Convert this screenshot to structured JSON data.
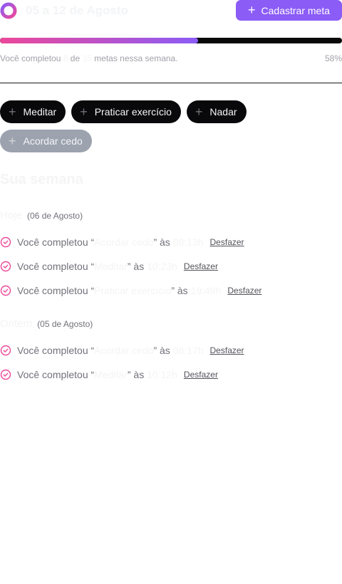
{
  "header": {
    "week_range": "05 a 12 de Agosto",
    "add_goal_label": "Cadastrar meta",
    "logo_icon": "in-orbit-logo-icon",
    "plus_icon": "plus-icon"
  },
  "progress": {
    "fraction": 0.58,
    "text_prefix": "Você completou",
    "completed": "8",
    "text_of": "de",
    "total": "15",
    "text_suffix": "metas nessa semana.",
    "percent_label": "58%",
    "gradient_start": "#ec4899",
    "gradient_end": "#8b5cf6"
  },
  "pending_goals": [
    {
      "label": "Meditar",
      "disabled": false
    },
    {
      "label": "Praticar exercício",
      "disabled": false
    },
    {
      "label": "Nadar",
      "disabled": false
    },
    {
      "label": "Acordar cedo",
      "disabled": true
    }
  ],
  "week": {
    "title": "Sua semana",
    "days": [
      {
        "name": "Hoje",
        "date": "(06 de Agosto)",
        "entries": [
          {
            "prefix": "Você completou “",
            "goal": "Acordar cedo",
            "middle": "” às",
            "time": "08:13h",
            "undo": "Desfazer"
          },
          {
            "prefix": "Você completou “",
            "goal": "Meditar",
            "middle": "” às",
            "time": "10:23h",
            "undo": "Desfazer"
          },
          {
            "prefix": "Você completou “",
            "goal": "Praticar exercício",
            "middle": "” às",
            "time": "19:49h",
            "undo": "Desfazer"
          }
        ]
      },
      {
        "name": "Ontem",
        "date": "(05 de Agosto)",
        "entries": [
          {
            "prefix": "Você completou “",
            "goal": "Acordar cedo",
            "middle": "” às",
            "time": "08:17h",
            "undo": "Desfazer"
          },
          {
            "prefix": "Você completou “",
            "goal": "Meditar",
            "middle": "” às",
            "time": "10:12h",
            "undo": "Desfazer"
          }
        ]
      }
    ]
  },
  "colors": {
    "accent": "#8b5cf6",
    "check": "#ec4899"
  }
}
